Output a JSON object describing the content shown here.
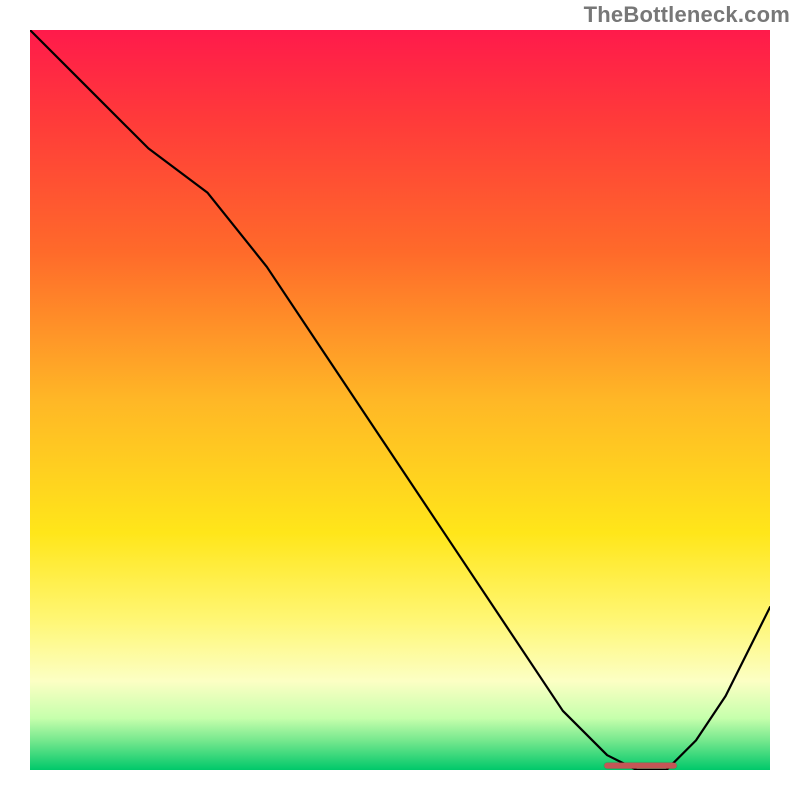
{
  "watermark": "TheBottleneck.com",
  "chart_data": {
    "type": "line",
    "title": "",
    "xlabel": "",
    "ylabel": "",
    "xlim": [
      0,
      100
    ],
    "ylim": [
      0,
      100
    ],
    "background_gradient": {
      "top": "#ff1a4b",
      "bottom": "#00c86a",
      "stops": [
        "red",
        "orange",
        "yellow",
        "light-yellow",
        "green"
      ]
    },
    "series": [
      {
        "name": "bottleneck-curve",
        "x": [
          0,
          8,
          16,
          24,
          32,
          40,
          48,
          56,
          64,
          72,
          78,
          82,
          86,
          90,
          94,
          100
        ],
        "y": [
          100,
          92,
          84,
          78,
          68,
          56,
          44,
          32,
          20,
          8,
          2,
          0,
          0,
          4,
          10,
          22
        ]
      }
    ],
    "annotations": [
      {
        "name": "optimal-range-marker",
        "x_start": 78,
        "x_end": 87,
        "y": 0.6
      }
    ]
  }
}
